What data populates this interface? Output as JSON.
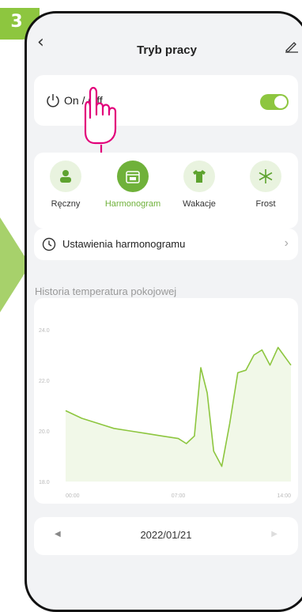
{
  "step": {
    "number": "3",
    "color": "#8dc63f"
  },
  "header": {
    "back_icon": "chevron-left-icon",
    "title": "Tryb pracy",
    "edit_icon": "pencil-icon"
  },
  "power": {
    "label": "On / Off",
    "toggle_on": true,
    "accent": "#8dc63f"
  },
  "modes": [
    {
      "label": "Ręczny",
      "icon": "person-icon",
      "active": false
    },
    {
      "label": "Harmonogram",
      "icon": "calendar-icon",
      "active": true
    },
    {
      "label": "Wakacje",
      "icon": "tshirt-icon",
      "active": false
    },
    {
      "label": "Frost",
      "icon": "snowflake-icon",
      "active": false
    }
  ],
  "schedule": {
    "label": "Ustawienia harmonogramu",
    "icon": "clock-icon"
  },
  "history": {
    "title": "Historia temperatura pokojowej"
  },
  "chart_data": {
    "type": "line",
    "y_ticks": [
      "24.0",
      "22.0",
      "20.0",
      "18.0"
    ],
    "x_ticks": [
      "00:00",
      "07:00",
      "14:00"
    ],
    "ylim": [
      18,
      24
    ],
    "xlim": [
      0,
      14
    ],
    "grid": false,
    "series_color": "#8dc63f",
    "x": [
      0,
      1,
      2,
      3,
      4,
      5,
      6,
      7,
      7.5,
      8,
      8.4,
      8.8,
      9.2,
      9.7,
      10.2,
      10.7,
      11.2,
      11.7,
      12.2,
      12.7,
      13.2,
      14
    ],
    "y": [
      20.8,
      20.5,
      20.3,
      20.1,
      20.0,
      19.9,
      19.8,
      19.7,
      19.5,
      19.8,
      22.5,
      21.5,
      19.2,
      18.6,
      20.3,
      22.3,
      22.4,
      23.0,
      23.2,
      22.6,
      23.3,
      22.6
    ]
  },
  "date_nav": {
    "date": "2022/01/21",
    "prev_icon": "triangle-left-icon",
    "next_icon": "triangle-right-icon"
  }
}
